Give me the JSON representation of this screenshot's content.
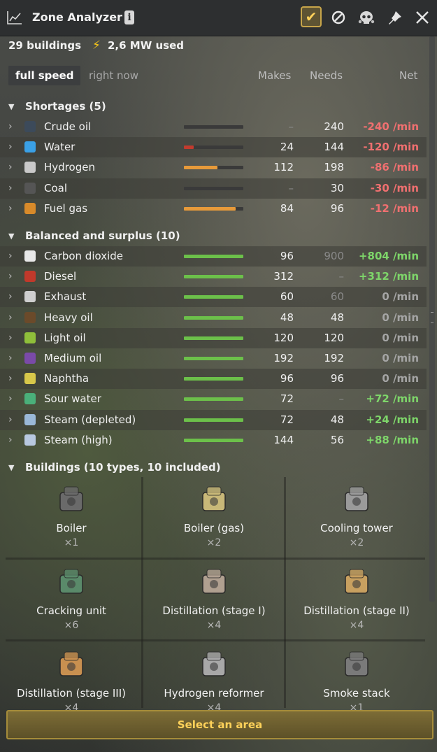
{
  "window": {
    "title": "Zone Analyzer",
    "info_glyph": "i",
    "buttons": [
      "check-icon",
      "block-icon",
      "skull-icon",
      "pin-icon",
      "close-icon"
    ]
  },
  "summary": {
    "buildings": "29 buildings",
    "power": "2,6 MW used"
  },
  "header": {
    "tab_active": "full speed",
    "tab_other": "right now",
    "col_makes": "Makes",
    "col_needs": "Needs",
    "col_net": "Net"
  },
  "shortages": {
    "title": "Shortages (5)",
    "rows": [
      {
        "name": "Crude oil",
        "makes": "–",
        "needs": "240",
        "net": "-240 /min",
        "fill": 0,
        "bar_color": "#3a3a3a",
        "icon_color": "#3c4a5a",
        "sign": "neg",
        "band": false
      },
      {
        "name": "Water",
        "makes": "24",
        "needs": "144",
        "net": "-120 /min",
        "fill": 0.17,
        "bar_color": "#c23b2e",
        "icon_color": "#3aa0e6",
        "sign": "neg",
        "band": true
      },
      {
        "name": "Hydrogen",
        "makes": "112",
        "needs": "198",
        "net": "-86 /min",
        "fill": 0.57,
        "bar_color": "#e79a3a",
        "icon_color": "#c9c9c9",
        "sign": "neg",
        "band": false
      },
      {
        "name": "Coal",
        "makes": "–",
        "needs": "30",
        "net": "-30 /min",
        "fill": 0,
        "bar_color": "#3a3a3a",
        "icon_color": "#555555",
        "sign": "neg",
        "band": true
      },
      {
        "name": "Fuel gas",
        "makes": "84",
        "needs": "96",
        "net": "-12 /min",
        "fill": 0.875,
        "bar_color": "#e79a3a",
        "icon_color": "#d88a2a",
        "sign": "neg",
        "band": false
      }
    ]
  },
  "balanced": {
    "title": "Balanced and surplus (10)",
    "rows": [
      {
        "name": "Carbon dioxide",
        "makes": "96",
        "needs": "900",
        "net": "+804 /min",
        "fill": 1,
        "bar_color": "#6cc04a",
        "icon_color": "#e8e8e8",
        "sign": "pos",
        "needs_dim": true,
        "band": true
      },
      {
        "name": "Diesel",
        "makes": "312",
        "needs": "–",
        "net": "+312 /min",
        "fill": 1,
        "bar_color": "#6cc04a",
        "icon_color": "#c0392b",
        "sign": "pos",
        "needs_dim": true,
        "band": false
      },
      {
        "name": "Exhaust",
        "makes": "60",
        "needs": "60",
        "net": "0 /min",
        "fill": 1,
        "bar_color": "#6cc04a",
        "icon_color": "#cfcfcf",
        "sign": "zero",
        "needs_dim": true,
        "band": true
      },
      {
        "name": "Heavy oil",
        "makes": "48",
        "needs": "48",
        "net": "0 /min",
        "fill": 1,
        "bar_color": "#6cc04a",
        "icon_color": "#6b4a2a",
        "sign": "zero",
        "needs_dim": false,
        "band": false
      },
      {
        "name": "Light oil",
        "makes": "120",
        "needs": "120",
        "net": "0 /min",
        "fill": 1,
        "bar_color": "#6cc04a",
        "icon_color": "#8fbf3a",
        "sign": "zero",
        "needs_dim": false,
        "band": true
      },
      {
        "name": "Medium oil",
        "makes": "192",
        "needs": "192",
        "net": "0 /min",
        "fill": 1,
        "bar_color": "#6cc04a",
        "icon_color": "#7a4aa8",
        "sign": "zero",
        "needs_dim": false,
        "band": false
      },
      {
        "name": "Naphtha",
        "makes": "96",
        "needs": "96",
        "net": "0 /min",
        "fill": 1,
        "bar_color": "#6cc04a",
        "icon_color": "#d8c84a",
        "sign": "zero",
        "needs_dim": false,
        "band": true
      },
      {
        "name": "Sour water",
        "makes": "72",
        "needs": "–",
        "net": "+72 /min",
        "fill": 1,
        "bar_color": "#6cc04a",
        "icon_color": "#4ab07a",
        "sign": "pos",
        "needs_dim": true,
        "band": false
      },
      {
        "name": "Steam (depleted)",
        "makes": "72",
        "needs": "48",
        "net": "+24 /min",
        "fill": 1,
        "bar_color": "#6cc04a",
        "icon_color": "#9ab8d8",
        "sign": "pos",
        "needs_dim": false,
        "band": true
      },
      {
        "name": "Steam (high)",
        "makes": "144",
        "needs": "56",
        "net": "+88 /min",
        "fill": 1,
        "bar_color": "#6cc04a",
        "icon_color": "#b8c8e0",
        "sign": "pos",
        "needs_dim": false,
        "band": false
      }
    ]
  },
  "buildings": {
    "title": "Buildings (10 types, 10 included)",
    "items": [
      {
        "name": "Boiler",
        "count": "×1",
        "icon": "boiler-icon",
        "color": "#6a6a6a"
      },
      {
        "name": "Boiler (gas)",
        "count": "×2",
        "icon": "gas-boiler-icon",
        "color": "#c8b878"
      },
      {
        "name": "Cooling tower",
        "count": "×2",
        "icon": "cooling-tower-icon",
        "color": "#9a9a9a"
      },
      {
        "name": "Cracking unit",
        "count": "×6",
        "icon": "cracking-unit-icon",
        "color": "#5a8a6a"
      },
      {
        "name": "Distillation (stage I)",
        "count": "×4",
        "icon": "distillation-icon",
        "color": "#b0a090"
      },
      {
        "name": "Distillation (stage II)",
        "count": "×4",
        "icon": "distillation-icon",
        "color": "#c8a060"
      },
      {
        "name": "Distillation (stage III)",
        "count": "×4",
        "icon": "distillation-icon",
        "color": "#c89050"
      },
      {
        "name": "Hydrogen reformer",
        "count": "×4",
        "icon": "hydrogen-reformer-icon",
        "color": "#a8a8a8"
      },
      {
        "name": "Smoke stack",
        "count": "×1",
        "icon": "smoke-stack-icon",
        "color": "#7a7a7a"
      }
    ]
  },
  "footer": {
    "select_area": "Select an area"
  },
  "colors": {
    "accent": "#ffd25a",
    "negative": "#f07070",
    "positive": "#7ed66a",
    "bar_green": "#6cc04a",
    "bar_orange": "#e79a3a",
    "bar_red": "#c23b2e"
  }
}
